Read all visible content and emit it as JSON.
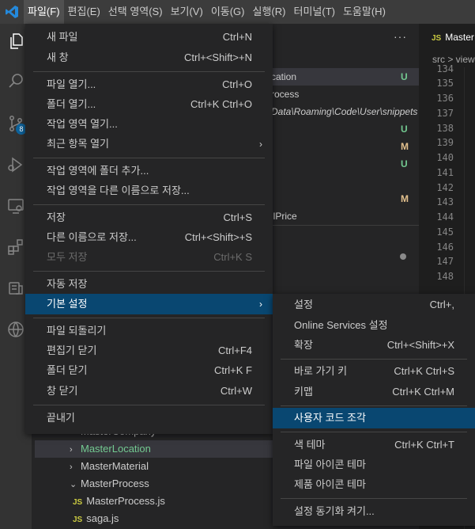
{
  "menubar": {
    "items": [
      {
        "label": "파일(F)"
      },
      {
        "label": "편집(E)"
      },
      {
        "label": "선택 영역(S)"
      },
      {
        "label": "보기(V)"
      },
      {
        "label": "이동(G)"
      },
      {
        "label": "실행(R)"
      },
      {
        "label": "터미널(T)"
      },
      {
        "label": "도움말(H)"
      }
    ]
  },
  "activitybar": {
    "icons": [
      "files-icon",
      "search-icon",
      "source-control-icon",
      "run-debug-icon",
      "remote-explorer-icon",
      "extensions-icon",
      "database-icon",
      "globe-icon"
    ],
    "scm_badge": "8"
  },
  "scm_changes": [
    {
      "text": "cation",
      "status": "U"
    },
    {
      "text": "rocess",
      "status": ""
    },
    {
      "text": "Data\\Roaming\\Code\\User\\snippets",
      "status": ""
    },
    {
      "text": "",
      "status": "U"
    },
    {
      "text": "",
      "status": "M"
    },
    {
      "text": "",
      "status": "U"
    },
    {
      "text": "",
      "status": "M"
    },
    {
      "text": "llPrice",
      "status": ""
    }
  ],
  "explorer": {
    "more_label": "···",
    "items": [
      {
        "label": "MasterCompany",
        "kind": "folder"
      },
      {
        "label": "MasterLocation",
        "kind": "folder"
      },
      {
        "label": "MasterMaterial",
        "kind": "folder"
      },
      {
        "label": "MasterProcess",
        "kind": "folder-open"
      },
      {
        "label": "MasterProcess.js",
        "kind": "file"
      },
      {
        "label": "saga.js",
        "kind": "file"
      }
    ],
    "js_label": "JS"
  },
  "editor": {
    "tab_label": "Master",
    "breadcrumb": "src > view",
    "line_numbers": [
      "134",
      "135",
      "136",
      "137",
      "138",
      "139",
      "140",
      "141",
      "142",
      "143",
      "144",
      "145",
      "146",
      "147",
      "148"
    ]
  },
  "file_menu": {
    "items": [
      {
        "label": "새 파일",
        "key": "Ctrl+N"
      },
      {
        "label": "새 창",
        "key": "Ctrl+<Shift>+N"
      },
      {
        "label": "파일 열기...",
        "key": "Ctrl+O"
      },
      {
        "label": "폴더 열기...",
        "key": "Ctrl+K Ctrl+O"
      },
      {
        "label": "작업 영역 열기...",
        "key": ""
      },
      {
        "label": "최근 항목 열기",
        "key": "",
        "arrow": "›"
      },
      {
        "label": "작업 영역에 폴더 추가...",
        "key": ""
      },
      {
        "label": "작업 영역을 다른 이름으로 저장...",
        "key": ""
      },
      {
        "label": "저장",
        "key": "Ctrl+S"
      },
      {
        "label": "다른 이름으로 저장...",
        "key": "Ctrl+<Shift>+S"
      },
      {
        "label": "모두 저장",
        "key": "Ctrl+K S"
      },
      {
        "label": "자동 저장",
        "key": ""
      },
      {
        "label": "기본 설정",
        "key": "",
        "arrow": "›"
      },
      {
        "label": "파일 되돌리기",
        "key": ""
      },
      {
        "label": "편집기 닫기",
        "key": "Ctrl+F4"
      },
      {
        "label": "폴더 닫기",
        "key": "Ctrl+K F"
      },
      {
        "label": "창 닫기",
        "key": "Ctrl+W"
      },
      {
        "label": "끝내기",
        "key": ""
      }
    ]
  },
  "preferences_menu": {
    "items": [
      {
        "label": "설정",
        "key": "Ctrl+,"
      },
      {
        "label": "Online Services 설정",
        "key": ""
      },
      {
        "label": "확장",
        "key": "Ctrl+<Shift>+X"
      },
      {
        "label": "바로 가기 키",
        "key": "Ctrl+K Ctrl+S"
      },
      {
        "label": "키맵",
        "key": "Ctrl+K Ctrl+M"
      },
      {
        "label": "사용자 코드 조각",
        "key": ""
      },
      {
        "label": "색 테마",
        "key": "Ctrl+K Ctrl+T"
      },
      {
        "label": "파일 아이콘 테마",
        "key": ""
      },
      {
        "label": "제품 아이콘 테마",
        "key": ""
      },
      {
        "label": "설정 동기화 켜기...",
        "key": ""
      }
    ]
  },
  "colors": {
    "accent": "#094771",
    "git_untracked": "#73c991",
    "git_modified": "#e2c08d",
    "vscode_blue": "#2489db"
  }
}
